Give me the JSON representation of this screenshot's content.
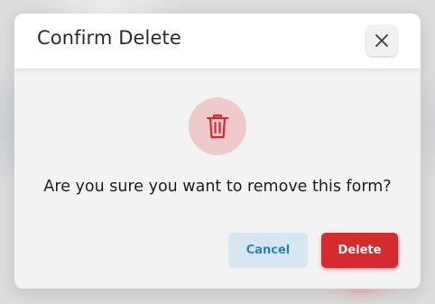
{
  "dialog": {
    "title": "Confirm Delete",
    "close_icon": "close-icon",
    "warning_icon": "trash-icon",
    "message": "Are you sure you want to remove this form?",
    "buttons": {
      "cancel_label": "Cancel",
      "delete_label": "Delete"
    }
  },
  "colors": {
    "danger": "#d42a30",
    "danger_soft": "#efcaca",
    "secondary_bg": "#d6e7f2",
    "secondary_text": "#2f7fb3"
  }
}
